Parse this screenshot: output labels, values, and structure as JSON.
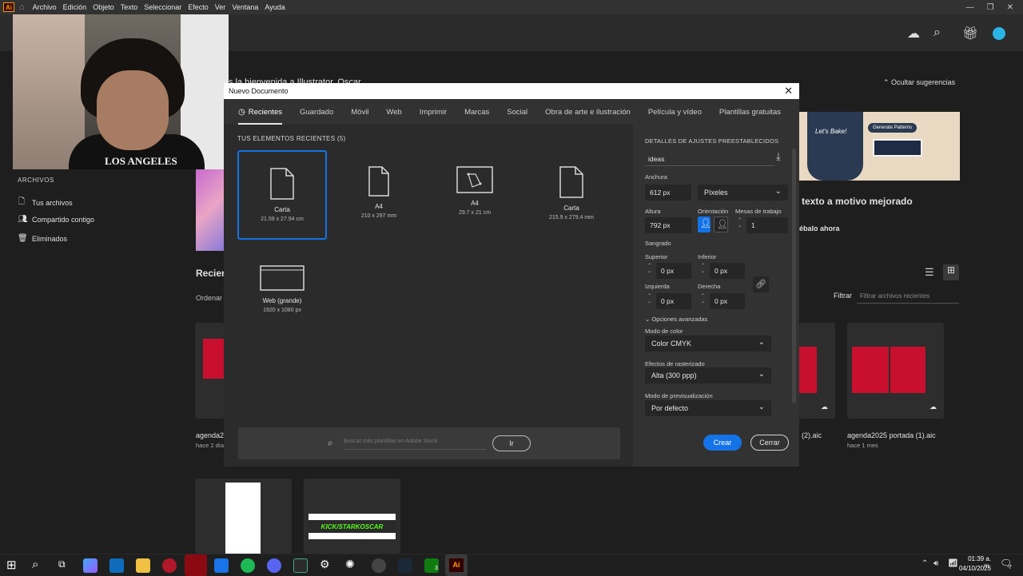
{
  "menubar": {
    "logo": "Ai",
    "items": [
      "Archivo",
      "Edición",
      "Objeto",
      "Texto",
      "Seleccionar",
      "Efecto",
      "Ver",
      "Ventana",
      "Ayuda"
    ],
    "window_controls": [
      "—",
      "❐",
      "✕"
    ]
  },
  "home": {
    "welcome": "s la bienvenida a Illustrator, Oscar",
    "hide_suggestions": "Ocultar sugerencias",
    "promo_title": "texto a motivo mejorado",
    "promo_cta": "ébalo ahora",
    "promo_badge": "Generate Patterns",
    "promo_tagline": "Let's Bake!",
    "recent_heading": "Recien",
    "sort_label": "Ordenar",
    "filter_label": "Filtrar",
    "filter_placeholder": "Filtrar archivos recientes",
    "nav_head": "ARCHIVOS",
    "nav_items": [
      "Tus archivos",
      "Compartido contigo",
      "Eliminados"
    ],
    "files": [
      {
        "name": "agenda20",
        "time": "hace 2 días"
      },
      {
        "name": "(2).aic",
        "time": ""
      },
      {
        "name": "agenda2025 portada (1).aic",
        "time": "hace 1 mes"
      }
    ],
    "kick_label": "KICK/STARKOSCAR",
    "webcam_shirt": "LOS ANGELES"
  },
  "dialog": {
    "title": "Nuevo Documento",
    "tabs": [
      "Recientes",
      "Guardado",
      "Móvil",
      "Web",
      "Imprimir",
      "Marcas",
      "Social",
      "Obra de arte e ilustración",
      "Película y vídeo",
      "Plantillas gratuitas"
    ],
    "recent_heading": "TUS ELEMENTOS RECIENTES (5)",
    "presets": [
      {
        "name": "Carta",
        "dims": "21.59 x 27.94 cm"
      },
      {
        "name": "A4",
        "dims": "210 x 297 mm"
      },
      {
        "name": "A4",
        "dims": "29.7 x 21 cm"
      },
      {
        "name": "Carta",
        "dims": "215.9 x 279.4 mm"
      },
      {
        "name": "Web (grande)",
        "dims": "1920 x 1080 px"
      }
    ],
    "search_placeholder": "Buscar más plantillas en Adobe Stock",
    "go_button": "Ir",
    "details": {
      "heading": "DETALLES DE AJUSTES PREESTABLECIDOS",
      "doc_name": "ideas",
      "width_label": "Anchura",
      "width": "612 px",
      "units": "Píxeles",
      "height_label": "Altura",
      "height": "792 px",
      "orientation_label": "Orientación",
      "artboards_label": "Mesas de trabajo",
      "artboards": "1",
      "bleed_label": "Sangrado",
      "top_label": "Superior",
      "top": "0 px",
      "bottom_label": "Inferior",
      "bottom": "0 px",
      "left_label": "Izquierda",
      "left": "0 px",
      "right_label": "Derecha",
      "right": "0 px",
      "advanced": "Opciones avanzadas",
      "color_mode_label": "Modo de color",
      "color_mode": "Color CMYK",
      "raster_label": "Efectos de rasterizado",
      "raster": "Alta (300 ppp)",
      "preview_label": "Modo de previsualización",
      "preview": "Por defecto",
      "create": "Crear",
      "close": "Cerrar"
    }
  },
  "taskbar": {
    "time": "01:39 a. m.",
    "date": "04/10/2025",
    "notif_count": "7",
    "app_label": "Ai",
    "badge": "3"
  },
  "colors": {
    "accent": "#1473e6",
    "dialog_bg": "#323232",
    "panel_bg": "#2b2b2b",
    "brand_red": "#c8102e"
  }
}
